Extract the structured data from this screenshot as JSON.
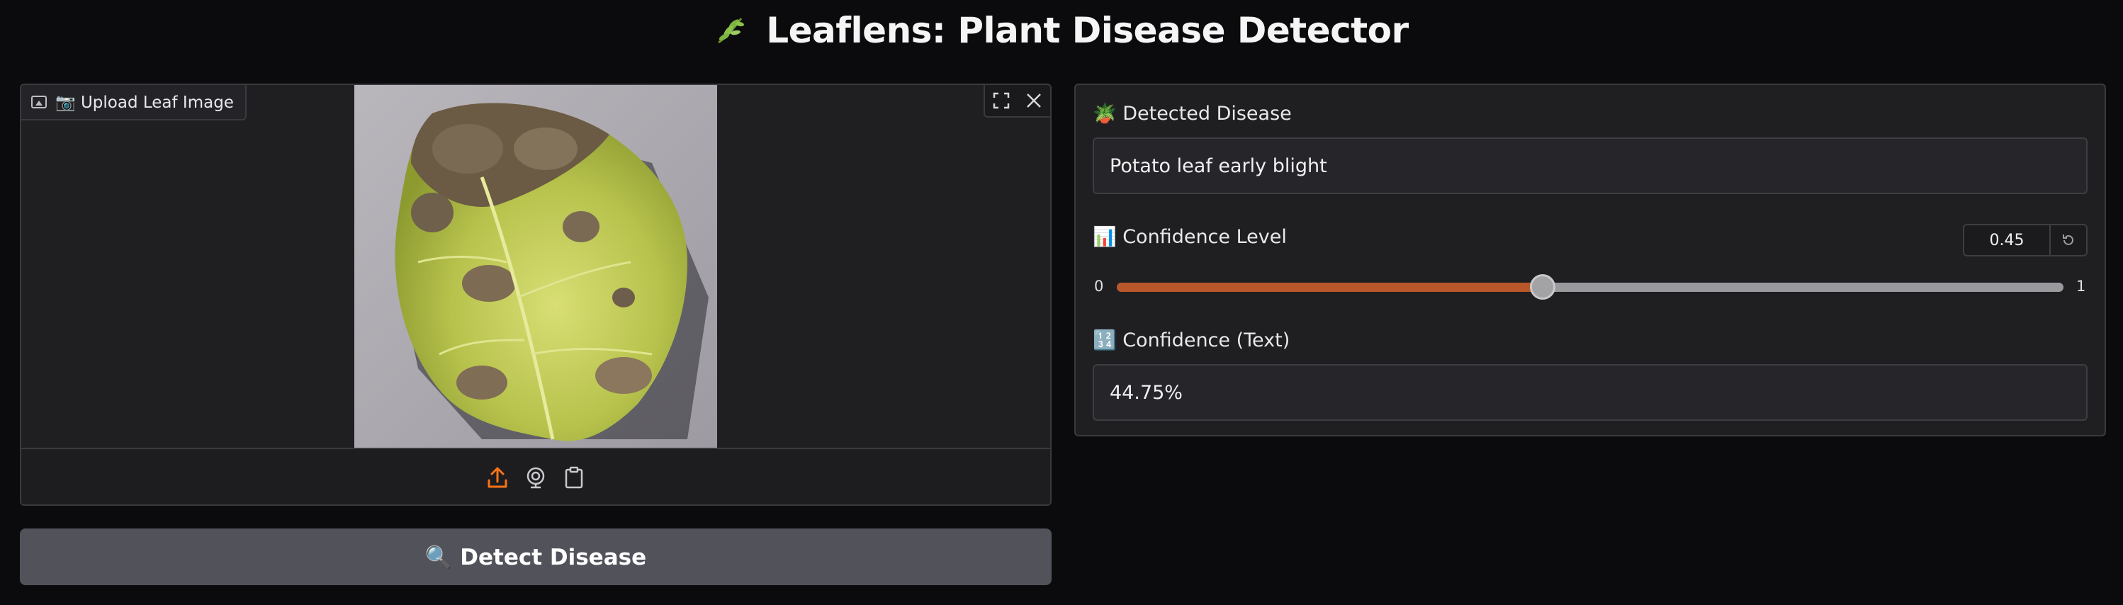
{
  "header": {
    "icon": "seedling-icon",
    "title": "Leaflens: Plant Disease Detector"
  },
  "uploader": {
    "label": "📷 Upload Leaf Image",
    "toolbar_icons": [
      "fullscreen-icon",
      "close-icon"
    ],
    "source_icons": [
      "upload-icon",
      "webcam-icon",
      "clipboard-icon"
    ]
  },
  "detect_button": {
    "label": "🔍 Detect Disease"
  },
  "results": {
    "disease_label": "🪴 Detected Disease",
    "disease_value": "Potato leaf early blight",
    "confidence_label": "📊 Confidence Level",
    "confidence_number": "0.45",
    "confidence_fraction": 0.45,
    "slider_min": "0",
    "slider_max": "1",
    "confidence_text_label": "🔢 Confidence (Text)",
    "confidence_text_value": "44.75%"
  },
  "colors": {
    "accent": "#b8572a",
    "upload_icon": "#f97316",
    "button_bg": "#52525b",
    "panel_bg": "#1f1f22",
    "page_bg": "#0b0b0d"
  }
}
